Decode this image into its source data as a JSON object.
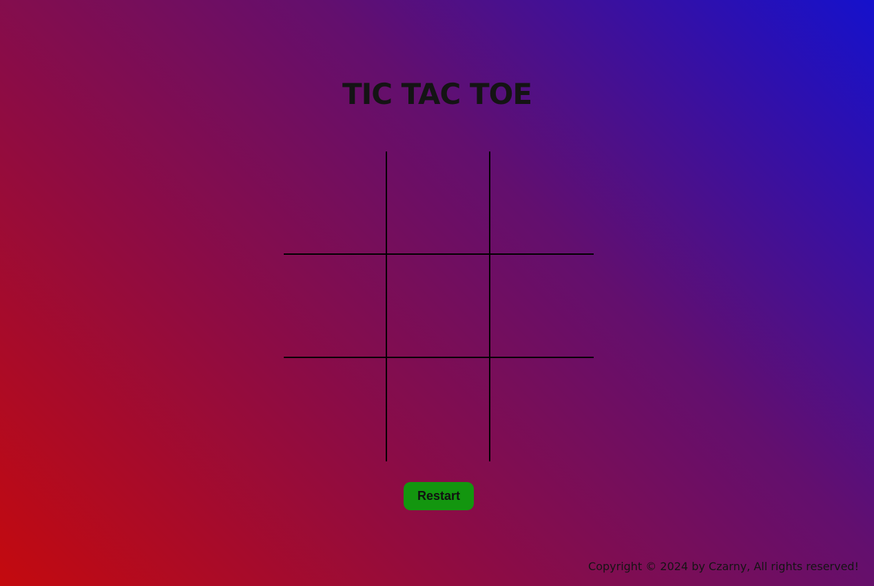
{
  "title": "TIC TAC TOE",
  "board": {
    "cells": [
      "",
      "",
      "",
      "",
      "",
      "",
      "",
      "",
      ""
    ]
  },
  "restart_label": "Restart",
  "footer": "Copyright © 2024 by Czarny, All rights reserved!",
  "colors": {
    "background_start": "#c40a0e",
    "background_end": "#1511cc",
    "button": "#13960f",
    "grid_line": "#000000"
  }
}
